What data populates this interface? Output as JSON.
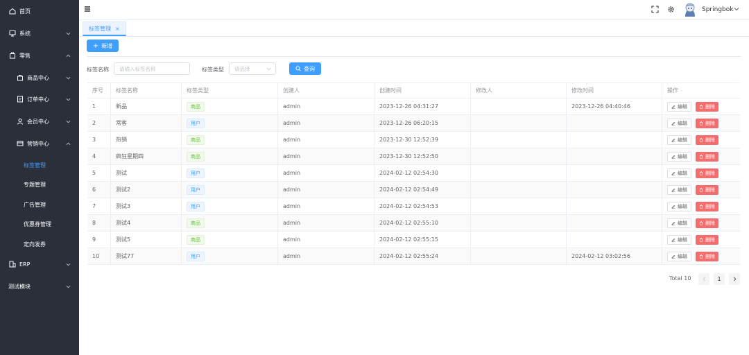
{
  "sidebar": {
    "items": [
      {
        "label": "首页",
        "icon": "home-icon"
      },
      {
        "label": "系统",
        "icon": "monitor-icon"
      },
      {
        "label": "零售",
        "icon": "shop-icon"
      },
      {
        "label": "商品中心",
        "icon": "bag-icon"
      },
      {
        "label": "订单中心",
        "icon": "order-icon"
      },
      {
        "label": "会员中心",
        "icon": "member-icon"
      },
      {
        "label": "营销中心",
        "icon": "marketing-icon"
      },
      {
        "label": "标签管理"
      },
      {
        "label": "专题管理"
      },
      {
        "label": "广告管理"
      },
      {
        "label": "优惠券管理"
      },
      {
        "label": "定向发券"
      },
      {
        "label": "ERP",
        "icon": "erp-icon"
      },
      {
        "label": "测试模块"
      }
    ]
  },
  "header": {
    "username": "Springbok"
  },
  "tabs": [
    {
      "label": "标签管理",
      "close": "×"
    }
  ],
  "toolbar": {
    "add_label": "新增",
    "add_prefix": "+"
  },
  "filters": {
    "name_label": "标签名称",
    "name_placeholder": "请输入标签名称",
    "type_label": "标签类型",
    "type_placeholder": "请选择",
    "query_label": "查询"
  },
  "table": {
    "headers": [
      "序号",
      "标签名称",
      "标签类型",
      "创建人",
      "创建时间",
      "修改人",
      "修改时间",
      "操作"
    ],
    "edit_label": "编辑",
    "delete_label": "删除",
    "rows": [
      {
        "no": "1",
        "name": "新品",
        "type": "商品",
        "kind": "goods",
        "creator": "admin",
        "created": "2023-12-26 04:31:27",
        "modifier": "",
        "modified": "2023-12-26 04:40:46"
      },
      {
        "no": "2",
        "name": "常客",
        "type": "用户",
        "kind": "user",
        "creator": "admin",
        "created": "2023-12-26 06:20:15",
        "modifier": "",
        "modified": ""
      },
      {
        "no": "3",
        "name": "热销",
        "type": "商品",
        "kind": "goods",
        "creator": "admin",
        "created": "2023-12-30 12:52:39",
        "modifier": "",
        "modified": ""
      },
      {
        "no": "4",
        "name": "疯狂星期四",
        "type": "商品",
        "kind": "goods",
        "creator": "admin",
        "created": "2023-12-30 12:52:50",
        "modifier": "",
        "modified": ""
      },
      {
        "no": "5",
        "name": "测试",
        "type": "用户",
        "kind": "user",
        "creator": "admin",
        "created": "2024-02-12 02:54:30",
        "modifier": "",
        "modified": ""
      },
      {
        "no": "6",
        "name": "测试2",
        "type": "用户",
        "kind": "user",
        "creator": "admin",
        "created": "2024-02-12 02:54:49",
        "modifier": "",
        "modified": ""
      },
      {
        "no": "7",
        "name": "测试3",
        "type": "用户",
        "kind": "user",
        "creator": "admin",
        "created": "2024-02-12 02:54:53",
        "modifier": "",
        "modified": ""
      },
      {
        "no": "8",
        "name": "测试4",
        "type": "商品",
        "kind": "goods",
        "creator": "admin",
        "created": "2024-02-12 02:55:10",
        "modifier": "",
        "modified": ""
      },
      {
        "no": "9",
        "name": "测试5",
        "type": "商品",
        "kind": "goods",
        "creator": "admin",
        "created": "2024-02-12 02:55:15",
        "modifier": "",
        "modified": ""
      },
      {
        "no": "10",
        "name": "测试77",
        "type": "用户",
        "kind": "user",
        "creator": "admin",
        "created": "2024-02-12 02:55:24",
        "modifier": "",
        "modified": "2024-02-12 03:02:56"
      }
    ]
  },
  "pagination": {
    "total_label": "Total 10",
    "current_page": "1"
  },
  "colors": {
    "primary": "#409eff",
    "danger": "#f56c6c",
    "success": "#67c23a",
    "sidebar_bg": "#2b2f3a"
  }
}
